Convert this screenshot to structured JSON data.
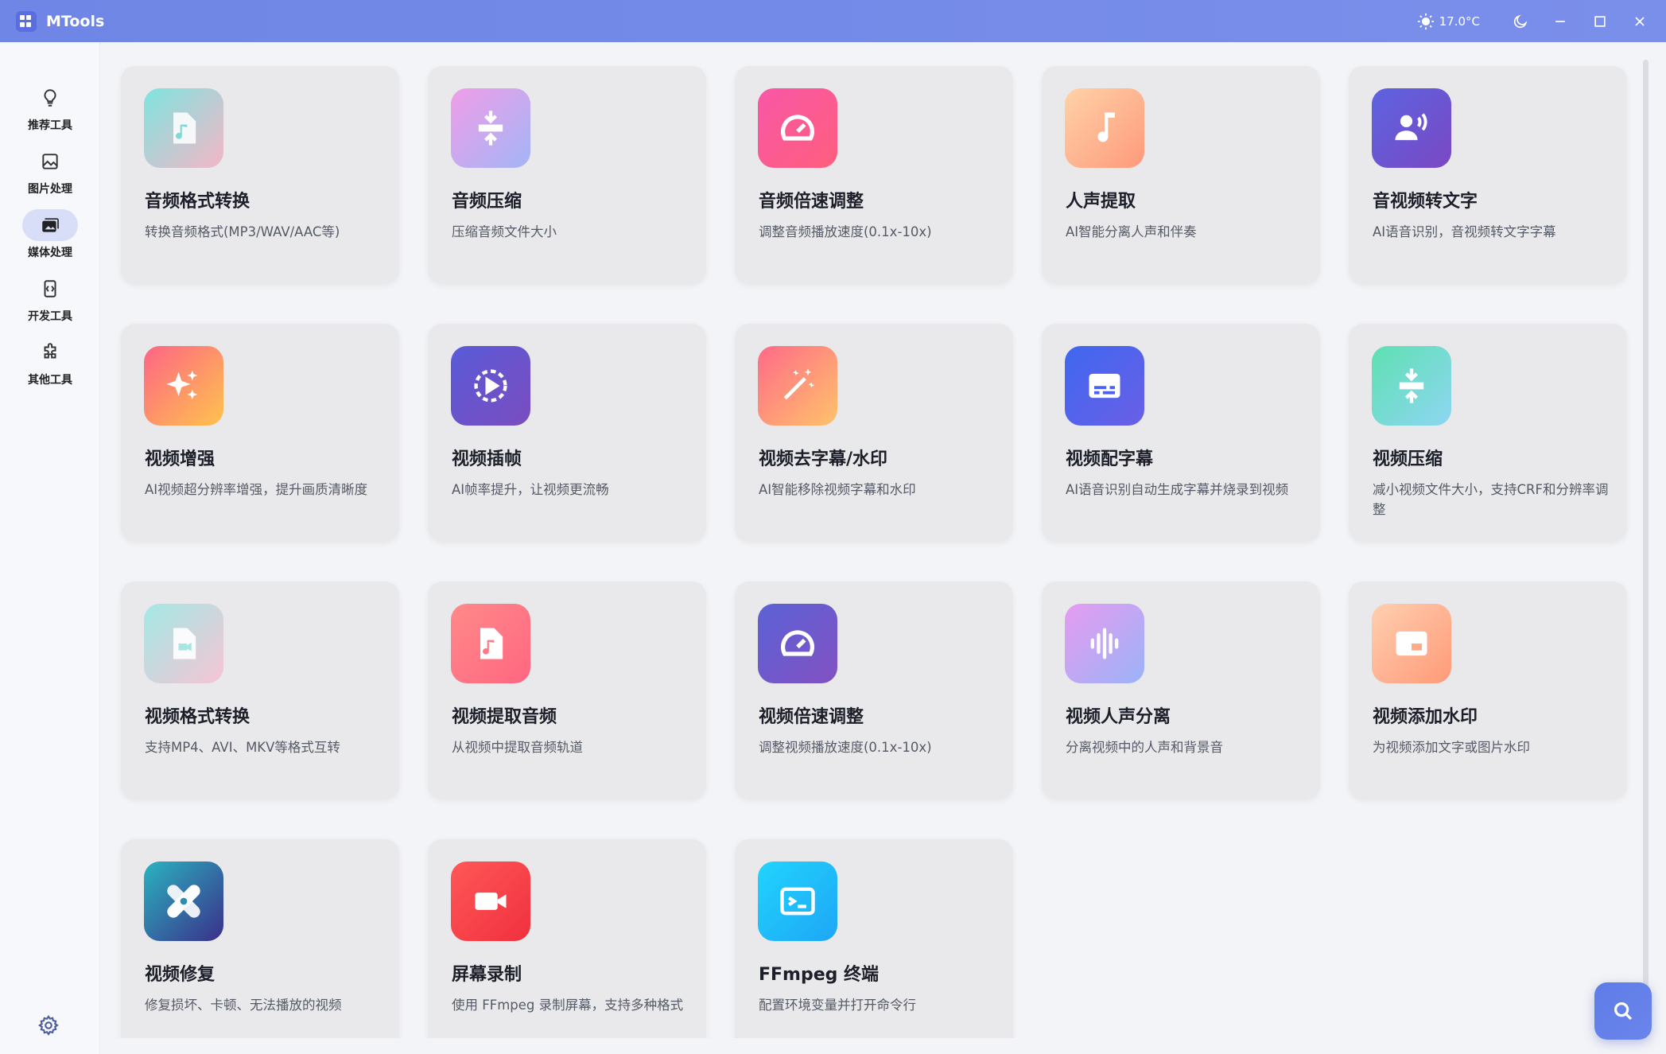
{
  "app": {
    "title": "MTools"
  },
  "titlebar": {
    "temperature": "17.0°C"
  },
  "sidebar": {
    "items": [
      {
        "label": "推荐工具",
        "icon": "lightbulb-icon",
        "active": false
      },
      {
        "label": "图片处理",
        "icon": "image-icon",
        "active": false
      },
      {
        "label": "媒体处理",
        "icon": "media-icon",
        "active": true
      },
      {
        "label": "开发工具",
        "icon": "code-icon",
        "active": false
      },
      {
        "label": "其他工具",
        "icon": "puzzle-icon",
        "active": false
      }
    ]
  },
  "tools": [
    {
      "title": "音频格式转换",
      "desc": "转换音频格式(MP3/WAV/AAC等)",
      "icon": "audio-file-icon",
      "gradient": "g-teal"
    },
    {
      "title": "音频压缩",
      "desc": "压缩音频文件大小",
      "icon": "compress-icon",
      "gradient": "g-purple"
    },
    {
      "title": "音频倍速调整",
      "desc": "调整音频播放速度(0.1x-10x)",
      "icon": "speedometer-icon",
      "gradient": "g-pink"
    },
    {
      "title": "人声提取",
      "desc": "AI智能分离人声和伴奏",
      "icon": "music-note-icon",
      "gradient": "g-peach"
    },
    {
      "title": "音视频转文字",
      "desc": "AI语音识别，音视频转文字字幕",
      "icon": "voice-user-icon",
      "gradient": "g-indigo"
    },
    {
      "title": "视频增强",
      "desc": "AI视频超分辨率增强，提升画质清晰度",
      "icon": "sparkle-icon",
      "gradient": "g-sunset"
    },
    {
      "title": "视频插帧",
      "desc": "AI帧率提升，让视频更流畅",
      "icon": "play-circle-icon",
      "gradient": "g-violet"
    },
    {
      "title": "视频去字幕/水印",
      "desc": "AI智能移除视频字幕和水印",
      "icon": "magic-wand-icon",
      "gradient": "g-orange"
    },
    {
      "title": "视频配字幕",
      "desc": "AI语音识别自动生成字幕并烧录到视频",
      "icon": "subtitles-icon",
      "gradient": "g-blue"
    },
    {
      "title": "视频压缩",
      "desc": "减小视频文件大小，支持CRF和分辨率调整",
      "icon": "compress-icon",
      "gradient": "g-mint"
    },
    {
      "title": "视频格式转换",
      "desc": "支持MP4、AVI、MKV等格式互转",
      "icon": "video-file-icon",
      "gradient": "g-softteal"
    },
    {
      "title": "视频提取音频",
      "desc": "从视频中提取音频轨道",
      "icon": "audio-file-icon",
      "gradient": "g-coral"
    },
    {
      "title": "视频倍速调整",
      "desc": "调整视频播放速度(0.1x-10x)",
      "icon": "speedometer-icon",
      "gradient": "g-slate"
    },
    {
      "title": "视频人声分离",
      "desc": "分离视频中的人声和背景音",
      "icon": "waveform-icon",
      "gradient": "g-lilac"
    },
    {
      "title": "视频添加水印",
      "desc": "为视频添加文字或图片水印",
      "icon": "watermark-icon",
      "gradient": "g-apricot"
    },
    {
      "title": "视频修复",
      "desc": "修复损坏、卡顿、无法播放的视频",
      "icon": "bandage-icon",
      "gradient": "g-ocean"
    },
    {
      "title": "屏幕录制",
      "desc": "使用 FFmpeg 录制屏幕，支持多种格式",
      "icon": "video-camera-icon",
      "gradient": "g-red"
    },
    {
      "title": "FFmpeg 终端",
      "desc": "配置环境变量并打开命令行",
      "icon": "terminal-icon",
      "gradient": "g-cyan"
    }
  ]
}
